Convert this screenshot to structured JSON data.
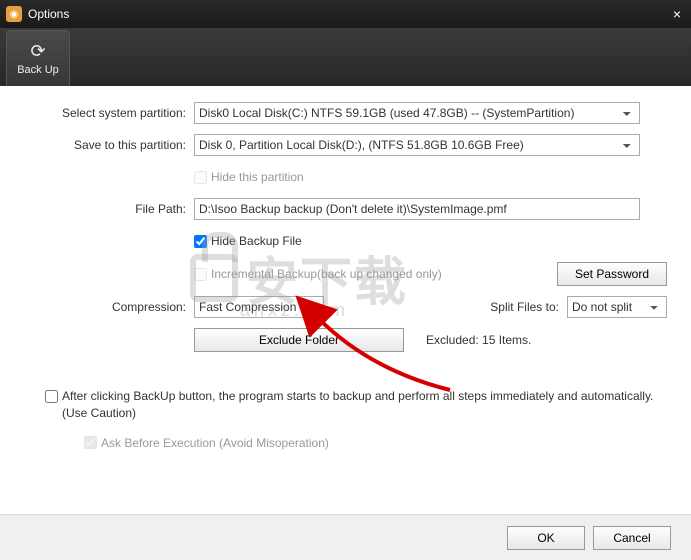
{
  "titlebar": {
    "title": "Options",
    "close": "×"
  },
  "ribbon": {
    "tab_icon": "⟳",
    "tab_label": "Back Up"
  },
  "labels": {
    "select_system_partition": "Select system partition:",
    "save_to_partition": "Save to this partition:",
    "file_path": "File Path:",
    "compression": "Compression:",
    "split_files": "Split Files to:"
  },
  "fields": {
    "system_partition": "Disk0  Local Disk(C:) NTFS 59.1GB (used 47.8GB) -- (SystemPartition)",
    "save_partition": "Disk 0, Partition Local Disk(D:), (NTFS 51.8GB 10.6GB Free)",
    "file_path": "D:\\Isoo Backup backup (Don't delete it)\\SystemImage.pmf",
    "compression": "Fast Compression",
    "split": "Do not split"
  },
  "checkboxes": {
    "hide_partition": "Hide this partition",
    "hide_backup_file": "Hide Backup File",
    "incremental": "Incremental Backup(back up changed only)",
    "auto_backup": "After clicking BackUp button, the program starts to backup and perform all steps immediately and automatically.(Use Caution)",
    "ask_before": "Ask Before Execution (Avoid Misoperation)"
  },
  "buttons": {
    "set_password": "Set Password",
    "exclude_folder": "Exclude Folder",
    "ok": "OK",
    "cancel": "Cancel"
  },
  "text": {
    "excluded": "Excluded: 15 Items."
  },
  "watermark": {
    "main": "安下载",
    "domain": "anxz.com"
  }
}
